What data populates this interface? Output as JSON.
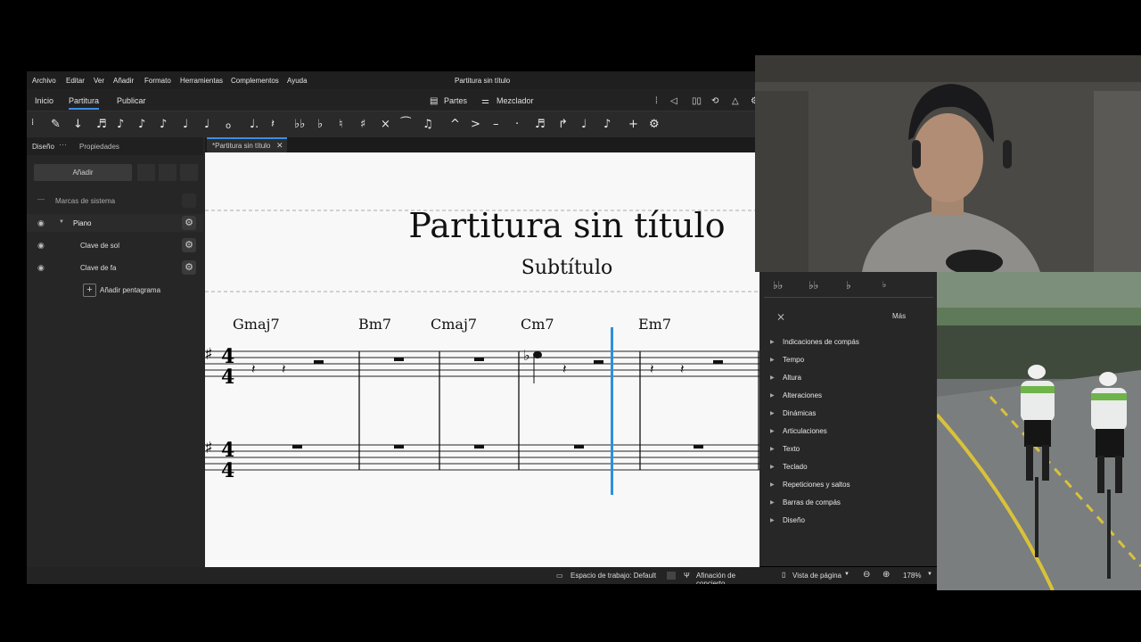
{
  "window": {
    "title": "Partitura sin título"
  },
  "menu": [
    "Archivo",
    "Editar",
    "Ver",
    "Añadir",
    "Formato",
    "Herramientas",
    "Complementos",
    "Ayuda"
  ],
  "tabs": [
    "Inicio",
    "Partitura",
    "Publicar"
  ],
  "top_actions": {
    "parts": "Partes",
    "mixer": "Mezclador"
  },
  "toolbar": {
    "icons": [
      "grip-icon",
      "pencil-icon",
      "pin-icon",
      "64th-note-icon",
      "32nd-note-icon",
      "16th-note-icon",
      "eighth-note-icon",
      "quarter-note-icon",
      "half-note-icon",
      "whole-note-icon",
      "dot-icon",
      "rest-icon",
      "double-flat-icon",
      "flat-icon",
      "natural-icon",
      "sharp-icon",
      "double-sharp-icon",
      "tie-icon",
      "slur-icon",
      "marcato-icon",
      "accent-icon",
      "tenuto-icon",
      "staccato-icon",
      "tuplet-icon",
      "flip-icon",
      "voice-1-icon",
      "voice-2-icon",
      "add-icon",
      "settings-icon"
    ]
  },
  "left_panel": {
    "tabs": [
      "Diseño",
      "Propiedades"
    ],
    "add_button": "Añadir",
    "system_marks": "Marcas de sistema",
    "instrument": "Piano",
    "staves": [
      "Clave de sol",
      "Clave de fa"
    ],
    "add_staff": "Añadir pentagrama"
  },
  "document_tab": "*Partitura sin título",
  "score": {
    "title": "Partitura sin título",
    "subtitle": "Subtítulo",
    "chords": [
      "Gmaj7",
      "Bm7",
      "Cmaj7",
      "Cm7",
      "Em7"
    ],
    "time_signature": "4/4"
  },
  "palette": {
    "more": "Más",
    "sections": [
      "Indicaciones de compás",
      "Tempo",
      "Altura",
      "Alteraciones",
      "Dinámicas",
      "Articulaciones",
      "Texto",
      "Teclado",
      "Repeticiones y saltos",
      "Barras de compás",
      "Diseño"
    ]
  },
  "status": {
    "workspace": "Espacio de trabajo: Default",
    "concert_pitch": "Afinación de concierto",
    "view": "Vista de página",
    "zoom": "178%"
  },
  "colors": {
    "accent": "#3b8de6",
    "cursor": "#2f8fdc",
    "app_bg": "#262626"
  }
}
